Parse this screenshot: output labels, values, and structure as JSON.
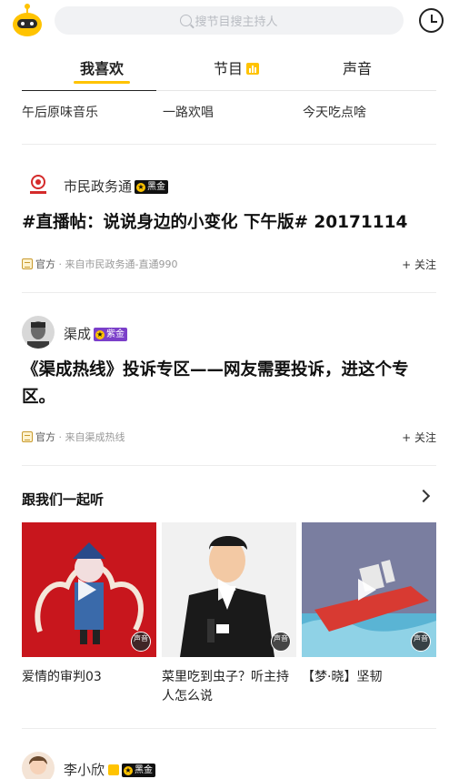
{
  "header": {
    "search_placeholder": "搜节目搜主持人"
  },
  "tabs": [
    {
      "label": "我喜欢",
      "active": true
    },
    {
      "label": "节目",
      "active": false
    },
    {
      "label": "声音",
      "active": false
    }
  ],
  "topics": [
    "午后原味音乐",
    "一路欢唱",
    "今天吃点啥"
  ],
  "posts": [
    {
      "author": "市民政务通",
      "badge": "黑金",
      "title": "#直播帖：说说身边的小变化 下午版# 20171114",
      "official": "官方",
      "source": "· 来自市民政务通-直通990",
      "follow": "+ 关注"
    },
    {
      "author": "渠成",
      "badge": "紫金",
      "title": "《渠成热线》投诉专区——网友需要投诉，进这个专区。",
      "official": "官方",
      "source": "· 来自渠成热线",
      "follow": "+ 关注"
    }
  ],
  "listen_section": {
    "title": "跟我们一起听",
    "tiles": [
      {
        "caption": "爱情的审判03",
        "tag": "声音"
      },
      {
        "caption": "菜里吃到虫子？听主持人怎么说",
        "tag": "声音"
      },
      {
        "caption": "【梦·晓】坚韧",
        "tag": "声音"
      }
    ]
  },
  "next_post": {
    "author": "李小欣",
    "badge": "黑金"
  },
  "colors": {
    "accent": "#ffc300",
    "black_gold": "#111111",
    "purple_gold": "#7b3fc9"
  }
}
